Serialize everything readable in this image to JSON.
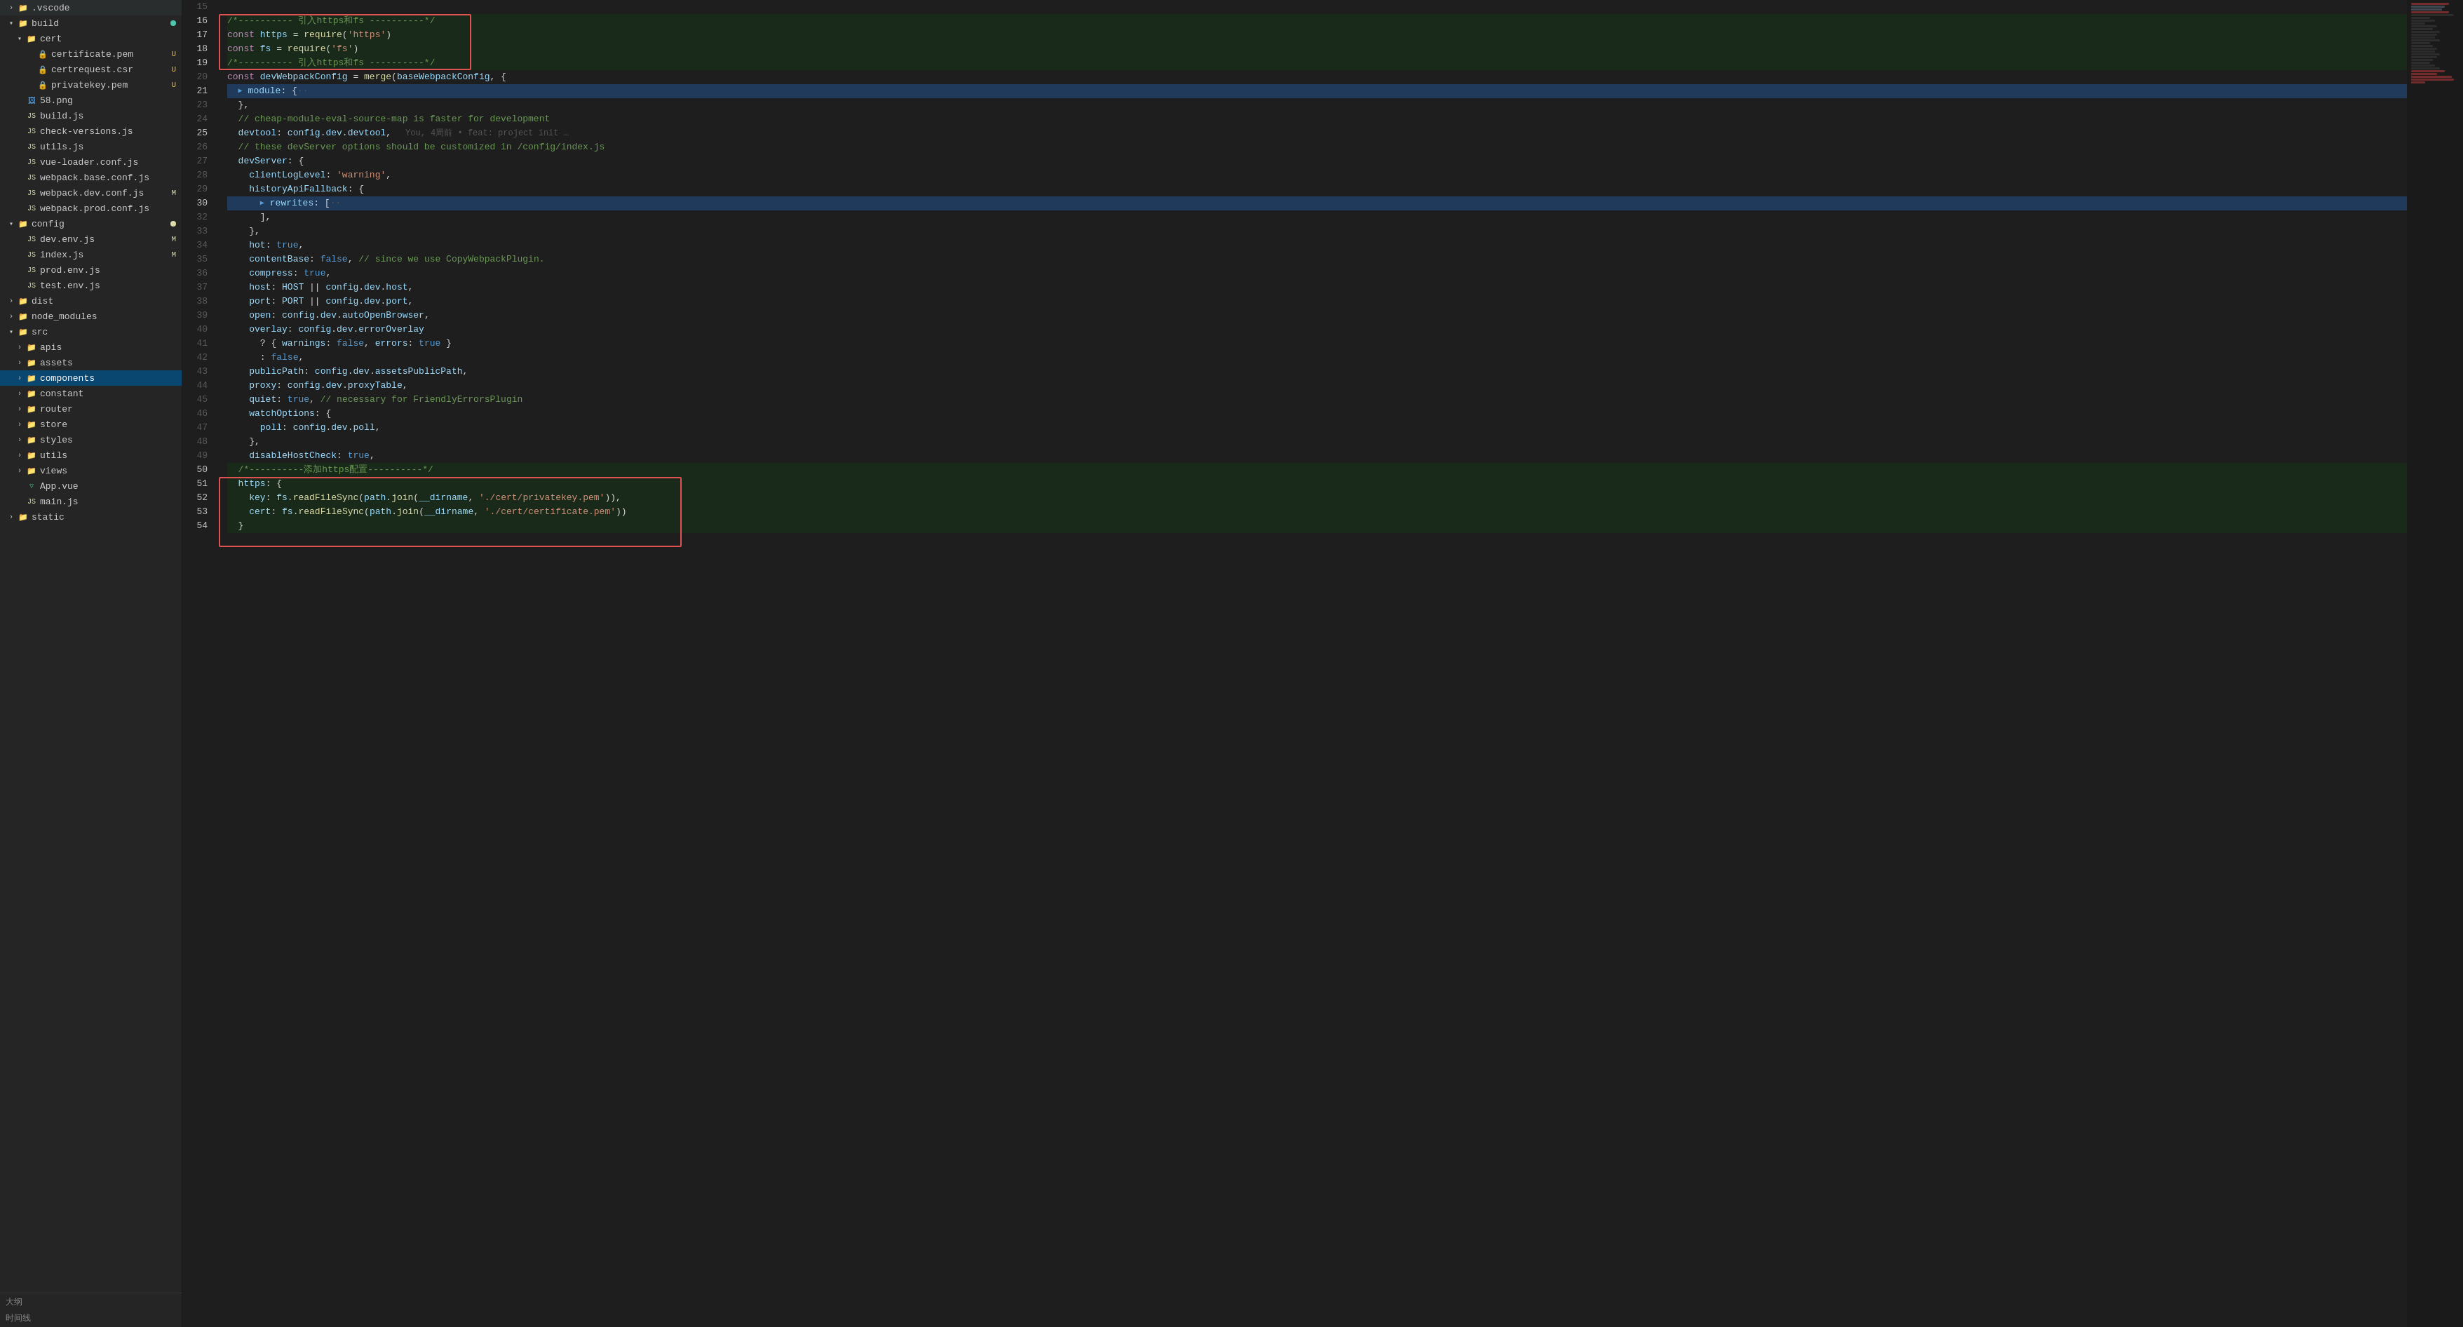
{
  "sidebar": {
    "title": "大纲",
    "bottom_label": "时间线",
    "sections": {
      "vscode": ".vscode",
      "build": "build",
      "cert": "cert",
      "cert_files": [
        {
          "name": "certificate.pem",
          "badge": "U",
          "icon": "🔒"
        },
        {
          "name": "certrequest.csr",
          "badge": "U",
          "icon": "🔒"
        },
        {
          "name": "privatekey.pem",
          "badge": "U",
          "icon": "🔒"
        }
      ],
      "build_files": [
        {
          "name": "58.png",
          "badge": "",
          "icon": "🖼"
        },
        {
          "name": "build.js",
          "badge": "",
          "icon": "JS"
        },
        {
          "name": "check-versions.js",
          "badge": "",
          "icon": "JS"
        },
        {
          "name": "utils.js",
          "badge": "",
          "icon": "JS"
        },
        {
          "name": "vue-loader.conf.js",
          "badge": "",
          "icon": "JS"
        },
        {
          "name": "webpack.base.conf.js",
          "badge": "",
          "icon": "JS"
        },
        {
          "name": "webpack.dev.conf.js",
          "badge": "M",
          "icon": "JS"
        },
        {
          "name": "webpack.prod.conf.js",
          "badge": "",
          "icon": "JS"
        }
      ],
      "config": "config",
      "config_dot": true,
      "config_files": [
        {
          "name": "dev.env.js",
          "badge": "M",
          "icon": "JS"
        },
        {
          "name": "index.js",
          "badge": "M",
          "icon": "JS"
        },
        {
          "name": "prod.env.js",
          "badge": "",
          "icon": "JS"
        },
        {
          "name": "test.env.js",
          "badge": "",
          "icon": "JS"
        }
      ],
      "dist": "dist",
      "node_modules": "node_modules",
      "src": "src",
      "src_children": [
        {
          "name": "apis",
          "type": "folder"
        },
        {
          "name": "assets",
          "type": "folder"
        },
        {
          "name": "components",
          "type": "folder",
          "active": true
        },
        {
          "name": "constant",
          "type": "folder"
        },
        {
          "name": "router",
          "type": "folder"
        },
        {
          "name": "store",
          "type": "folder"
        },
        {
          "name": "styles",
          "type": "folder"
        },
        {
          "name": "utils",
          "type": "folder"
        },
        {
          "name": "views",
          "type": "folder"
        },
        {
          "name": "App.vue",
          "type": "file",
          "icon": "V"
        },
        {
          "name": "main.js",
          "type": "file",
          "icon": "JS"
        }
      ],
      "static": "static"
    }
  },
  "editor": {
    "filename": "webpack.dev.conf.js",
    "lines": [
      {
        "num": 15,
        "content": "",
        "type": "empty"
      },
      {
        "num": 16,
        "content": "/*---------- 引入https和fs ----------*/",
        "type": "comment",
        "highlighted": true,
        "red_box_start": true
      },
      {
        "num": 17,
        "content": "const https = require('https')",
        "type": "code",
        "highlighted": true
      },
      {
        "num": 18,
        "content": "const fs = require('fs')",
        "type": "code",
        "highlighted": true
      },
      {
        "num": 19,
        "content": "/*---------- 引入https和fs ----------*/",
        "type": "comment",
        "highlighted": true,
        "red_box_end": true
      },
      {
        "num": 20,
        "content": "const devWebpackConfig = merge(baseWebpackConfig, {",
        "type": "code"
      },
      {
        "num": 21,
        "content": "  module: {··",
        "type": "code_collapsed",
        "selected": true
      },
      {
        "num": 23,
        "content": "  },",
        "type": "code"
      },
      {
        "num": 24,
        "content": "  // cheap-module-eval-source-map is faster for development",
        "type": "comment"
      },
      {
        "num": 25,
        "content": "  devtool: config.dev.devtool,",
        "type": "code",
        "blame": "You, 4周前 • feat: project init …"
      },
      {
        "num": 26,
        "content": "  // these devServer options should be customized in /config/index.js",
        "type": "comment"
      },
      {
        "num": 27,
        "content": "  devServer: {",
        "type": "code"
      },
      {
        "num": 28,
        "content": "    clientLogLevel: 'warning',",
        "type": "code"
      },
      {
        "num": 29,
        "content": "    historyApiFallback: {",
        "type": "code"
      },
      {
        "num": 30,
        "content": "      rewrites: [··",
        "type": "code_collapsed",
        "selected": true
      },
      {
        "num": 32,
        "content": "      ],",
        "type": "code"
      },
      {
        "num": 33,
        "content": "    },",
        "type": "code"
      },
      {
        "num": 34,
        "content": "    hot: true,",
        "type": "code"
      },
      {
        "num": 35,
        "content": "    contentBase: false, // since we use CopyWebpackPlugin.",
        "type": "code"
      },
      {
        "num": 36,
        "content": "    compress: true,",
        "type": "code"
      },
      {
        "num": 37,
        "content": "    host: HOST || config.dev.host,",
        "type": "code"
      },
      {
        "num": 38,
        "content": "    port: PORT || config.dev.port,",
        "type": "code"
      },
      {
        "num": 39,
        "content": "    open: config.dev.autoOpenBrowser,",
        "type": "code"
      },
      {
        "num": 40,
        "content": "    overlay: config.dev.errorOverlay",
        "type": "code"
      },
      {
        "num": 41,
        "content": "      ? { warnings: false, errors: true }",
        "type": "code"
      },
      {
        "num": 42,
        "content": "      : false,",
        "type": "code"
      },
      {
        "num": 43,
        "content": "    publicPath: config.dev.assetsPublicPath,",
        "type": "code"
      },
      {
        "num": 44,
        "content": "    proxy: config.dev.proxyTable,",
        "type": "code"
      },
      {
        "num": 45,
        "content": "    quiet: true, // necessary for FriendlyErrorsPlugin",
        "type": "code"
      },
      {
        "num": 46,
        "content": "    watchOptions: {",
        "type": "code"
      },
      {
        "num": 47,
        "content": "      poll: config.dev.poll,",
        "type": "code"
      },
      {
        "num": 48,
        "content": "    },",
        "type": "code"
      },
      {
        "num": 49,
        "content": "    disableHostCheck: true,",
        "type": "code"
      },
      {
        "num": 50,
        "content": "  /*----------添加https配置----------*/",
        "type": "comment",
        "highlighted2": true,
        "red_box2_start": true
      },
      {
        "num": 51,
        "content": "  https: {",
        "type": "code",
        "highlighted2": true
      },
      {
        "num": 52,
        "content": "    key: fs.readFileSync(path.join(__dirname, './cert/privatekey.pem')),",
        "type": "code",
        "highlighted2": true
      },
      {
        "num": 53,
        "content": "    cert: fs.readFileSync(path.join(__dirname, './cert/certificate.pem'))",
        "type": "code",
        "highlighted2": true
      },
      {
        "num": 54,
        "content": "  }",
        "type": "code",
        "highlighted2": true,
        "red_box2_end": true
      }
    ],
    "git_blame": "You, 4周前 • feat: project init …"
  },
  "status": {
    "bottom_left": "大纲",
    "bottom_right": "时间线"
  }
}
